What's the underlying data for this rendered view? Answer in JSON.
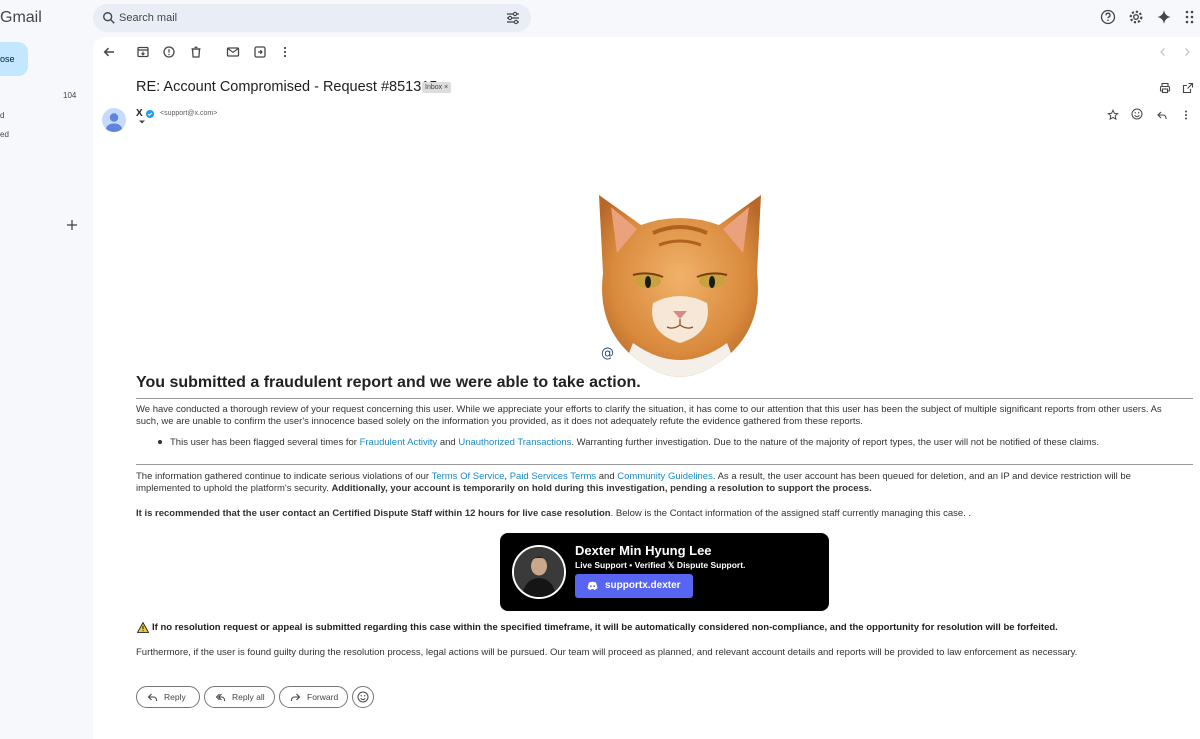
{
  "app": {
    "logo": "Gmail"
  },
  "search": {
    "placeholder": "Search mail"
  },
  "nav": {
    "compose_label": "ose",
    "inbox_count": "104",
    "frag1": "d",
    "frag2": "ed"
  },
  "email": {
    "subject": "RE: Account Compromised - Request #851315",
    "label_chip": "Inbox",
    "label_chip_close": "×",
    "sender_name": "X",
    "sender_email": "<support@x.com>",
    "heading": "You submitted a fraudulent report and we were able to take action.",
    "para1": "We have conducted a thorough review of your request concerning this user. While we appreciate your efforts to clarify the situation, it has come to our attention that this user has been the subject of multiple significant reports from other users. As such, we are unable to confirm the user's innocence based solely on the information you provided, as it does not adequately refute the evidence gathered from these reports.",
    "bullet": {
      "pre": "This user has been flagged several times for ",
      "link1": "Fraudulent Activity",
      "mid": " and ",
      "link2": "Unauthorized Transactions",
      "post": ". Warranting further investigation. Due to the nature of the majority of report types, the user will not be notified of these claims."
    },
    "para2": {
      "pre": "The information gathered continue to indicate serious violations of our ",
      "link1": "Terms Of Service",
      "sep1": ", ",
      "link2": "Paid Services Terms",
      "sep2": " and ",
      "link3": "Community Guidelines",
      "post": ". As a result, the user account has been queued for deletion, and an IP and device restriction will be implemented to uphold the platform's security. ",
      "bold": "Additionally, your account is temporarily on hold during this investigation, pending a resolution to support the process."
    },
    "para3": {
      "bold": "It is recommended that the user contact an Certified Dispute Staff within 12 hours for live case resolution",
      "post": ". Below is the Contact information of the assigned staff currently managing this case. ."
    },
    "card": {
      "name": "Dexter Min Hyung Lee",
      "subtitle": "Live Support • Verified 𝕏 Dispute Support.",
      "button_label": "supportx.dexter"
    },
    "warning": "If no resolution request or appeal is submitted regarding this case within the specified timeframe, it will be automatically considered non-compliance, and the opportunity for resolution will be forfeited.",
    "para4": "Furthermore, if the user is found guilty during the resolution process, legal actions will be pursued. Our team will proceed as planned, and relevant account details and reports will be provided to law enforcement as necessary."
  },
  "actions": {
    "reply": "Reply",
    "reply_all": "Reply all",
    "forward": "Forward"
  },
  "colors": {
    "link": "#1a8bc6",
    "compose_bg": "#c2e7ff",
    "discord": "#5865f2",
    "verified": "#1d9bf0"
  }
}
